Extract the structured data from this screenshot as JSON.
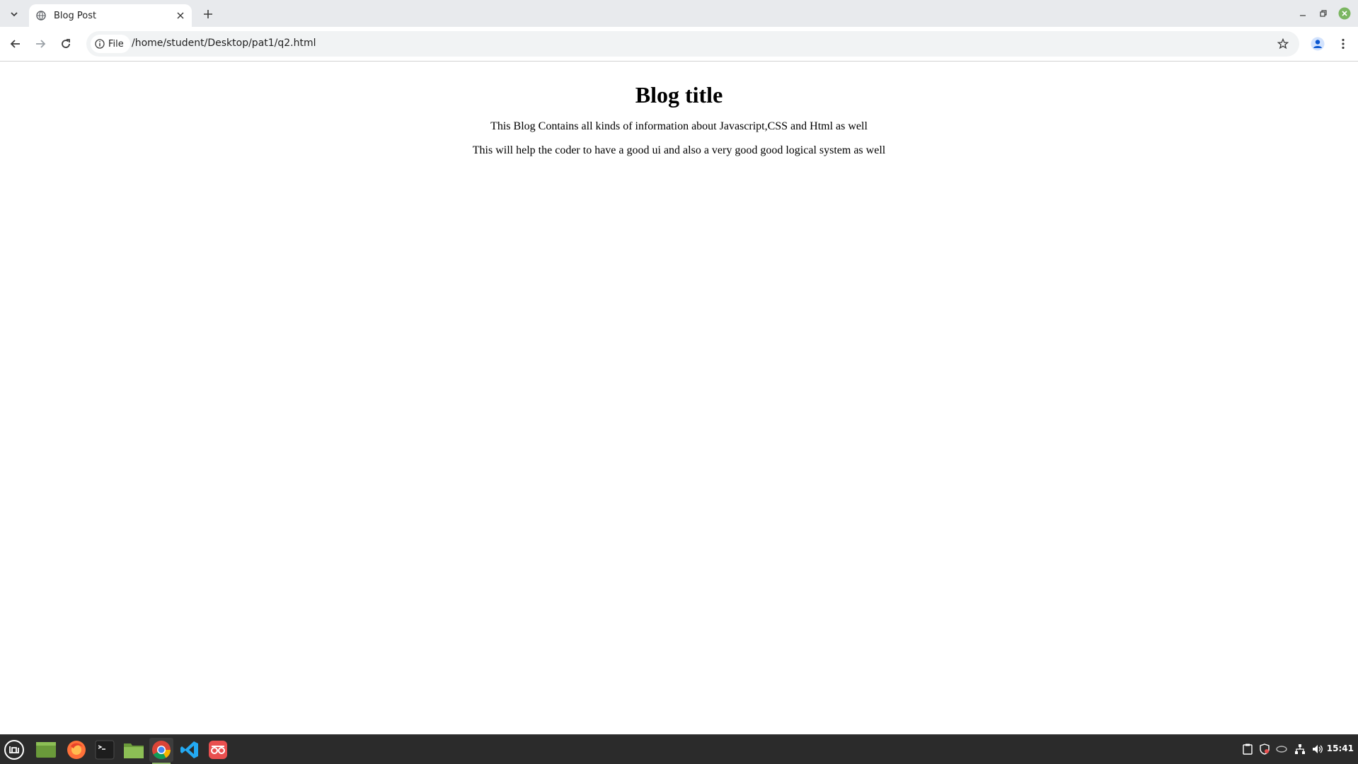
{
  "browser": {
    "tab": {
      "title": "Blog Post"
    },
    "address": {
      "chip_label": "File",
      "url": "/home/student/Desktop/pat1/q2.html"
    }
  },
  "page": {
    "heading": "Blog title",
    "paragraphs": [
      "This Blog Contains all kinds of information about Javascript,CSS and Html as well",
      "This will help the coder to have a good ui and also a very good good logical system as well"
    ]
  },
  "taskbar": {
    "apps": [
      "mint-menu-icon",
      "show-desktop-icon",
      "firefox-icon",
      "terminal-icon",
      "files-icon",
      "chrome-icon",
      "vscode-icon",
      "remote-viewer-icon"
    ],
    "active_app": "chrome-icon",
    "tray_icons": [
      "clipboard-icon",
      "shield-icon",
      "network-adapter-icon",
      "network-icon",
      "volume-icon"
    ],
    "clock": "15:41"
  },
  "colors": {
    "tabstrip_bg": "#e8eaed",
    "omnibox_bg": "#f1f3f4",
    "taskbar_bg": "#2b2b2b",
    "close_window": "#7bb661"
  }
}
